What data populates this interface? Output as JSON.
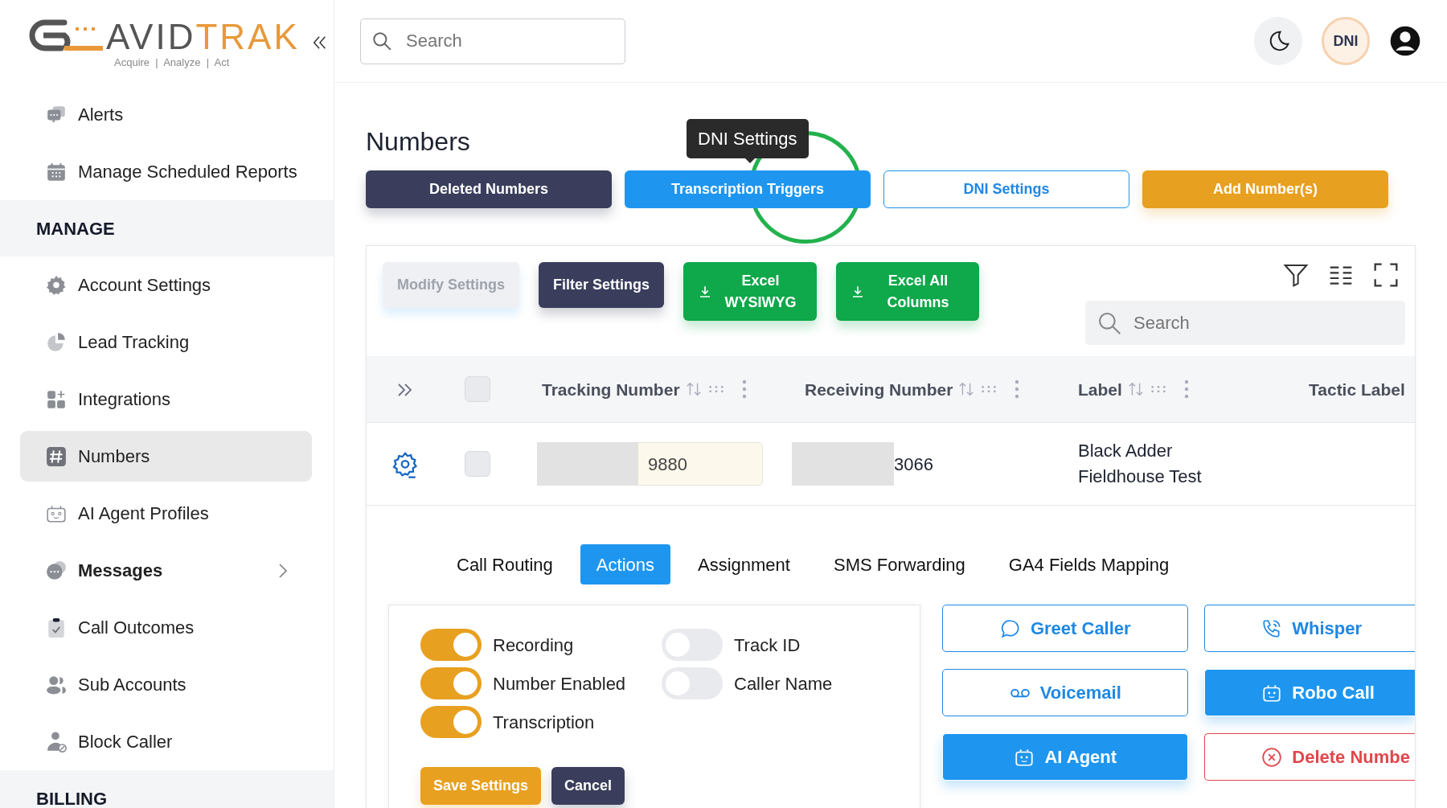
{
  "logo": {
    "brand_first": "AVID",
    "brand_second": "TRAK",
    "tagline": "Acquire  |  Analyze  |  Act"
  },
  "sidebar": {
    "items": [
      {
        "kind": "link",
        "label": "Alerts",
        "selected": false
      },
      {
        "kind": "link",
        "label": "Manage Scheduled Reports",
        "selected": false
      },
      {
        "kind": "header",
        "label": "MANAGE"
      },
      {
        "kind": "link",
        "label": "Account Settings",
        "selected": false
      },
      {
        "kind": "link",
        "label": "Lead Tracking",
        "selected": false
      },
      {
        "kind": "link",
        "label": "Integrations",
        "selected": false
      },
      {
        "kind": "link",
        "label": "Numbers",
        "selected": true
      },
      {
        "kind": "link",
        "label": "AI Agent Profiles",
        "selected": false
      },
      {
        "kind": "link",
        "label": "Messages",
        "selected": false,
        "expandable": true
      },
      {
        "kind": "link",
        "label": "Call Outcomes",
        "selected": false
      },
      {
        "kind": "link",
        "label": "Sub Accounts",
        "selected": false
      },
      {
        "kind": "link",
        "label": "Block Caller",
        "selected": false
      },
      {
        "kind": "header",
        "label": "BILLING"
      }
    ]
  },
  "header": {
    "search": {
      "placeholder": "Search"
    },
    "account_badge": "DNI"
  },
  "page": {
    "title": "Numbers",
    "buttons": [
      {
        "label": "Deleted Numbers",
        "kind": "dark"
      },
      {
        "label": "Transcription Triggers",
        "kind": "primary"
      },
      {
        "label": "DNI Settings",
        "kind": "outline"
      },
      {
        "label": "Add Number(s)",
        "kind": "warning"
      }
    ],
    "tooltip": "DNI Settings"
  },
  "toolbar": {
    "buttons": [
      {
        "label": "Modify Settings",
        "kind": "dark",
        "disabled": true
      },
      {
        "label": "Filter Settings",
        "kind": "dark",
        "disabled": false
      },
      {
        "label": "Excel WYSIWYG",
        "kind": "download",
        "disabled": false
      },
      {
        "label": "Excel All Columns",
        "kind": "download",
        "disabled": false
      }
    ],
    "search": {
      "placeholder": "Search"
    }
  },
  "table": {
    "select_all_checked": false,
    "columns": [
      "Tracking Number",
      "Receiving Number",
      "Label",
      "Tactic Label"
    ],
    "rows": [
      {
        "checked": false,
        "tracking_number": "9880",
        "receiving_number": "3066",
        "label": "Black Adder Fieldhouse Test"
      }
    ]
  },
  "detail_tabs": [
    {
      "label": "Call Routing",
      "selected": false
    },
    {
      "label": "Actions",
      "selected": true
    },
    {
      "label": "Assignment",
      "selected": false
    },
    {
      "label": "SMS Forwarding",
      "selected": false
    },
    {
      "label": "GA4 Fields Mapping",
      "selected": false
    }
  ],
  "settings": {
    "toggles": [
      {
        "label": "Recording",
        "on": true
      },
      {
        "label": "Track ID",
        "on": false
      },
      {
        "label": "Number Enabled",
        "on": true
      },
      {
        "label": "Caller Name",
        "on": false
      },
      {
        "label": "Transcription",
        "on": true
      }
    ],
    "buttons": [
      {
        "label": "Save Settings",
        "kind": "warning"
      },
      {
        "label": "Cancel",
        "kind": "dark"
      }
    ]
  },
  "actions": [
    {
      "label": "Greet Caller",
      "kind": "outline"
    },
    {
      "label": "Whisper",
      "kind": "outline"
    },
    {
      "label": "Voicemail",
      "kind": "outline"
    },
    {
      "label": "Robo Call",
      "kind": "filled"
    },
    {
      "label": "AI Agent",
      "kind": "filled"
    },
    {
      "label": "Delete Numbe",
      "kind": "danger"
    }
  ]
}
